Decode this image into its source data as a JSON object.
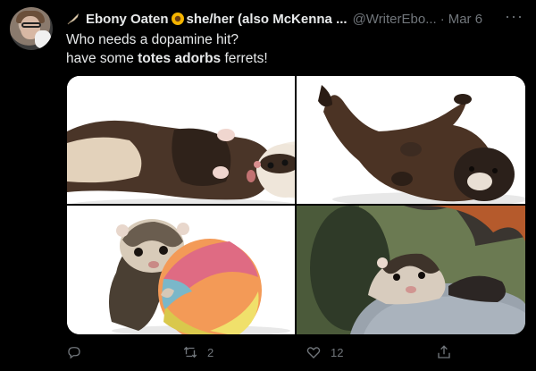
{
  "tweet": {
    "author_name": "Ebony Oaten",
    "author_suffix": "she/her (also McKenna ...",
    "handle": "@WriterEbo...",
    "separator": "·",
    "date": "Mar 6",
    "more_label": "···",
    "text_line1": "Who needs a dopamine hit?",
    "text_line2_before": "have some ",
    "text_line2_bold": "totes adorbs",
    "text_line2_after": " ferrets!"
  },
  "media": {
    "images": [
      {
        "label": "ferret lying on back on white background"
      },
      {
        "label": "dark ferret rolling on back"
      },
      {
        "label": "ferret with colorful ball"
      },
      {
        "label": "ferret peeking out of grey hoodie"
      }
    ]
  },
  "actions": {
    "reply_count": "",
    "retweet_count": "2",
    "like_count": "12"
  },
  "colors": {
    "background": "#000000",
    "text": "#e7e9ea",
    "secondary": "#71767b"
  }
}
